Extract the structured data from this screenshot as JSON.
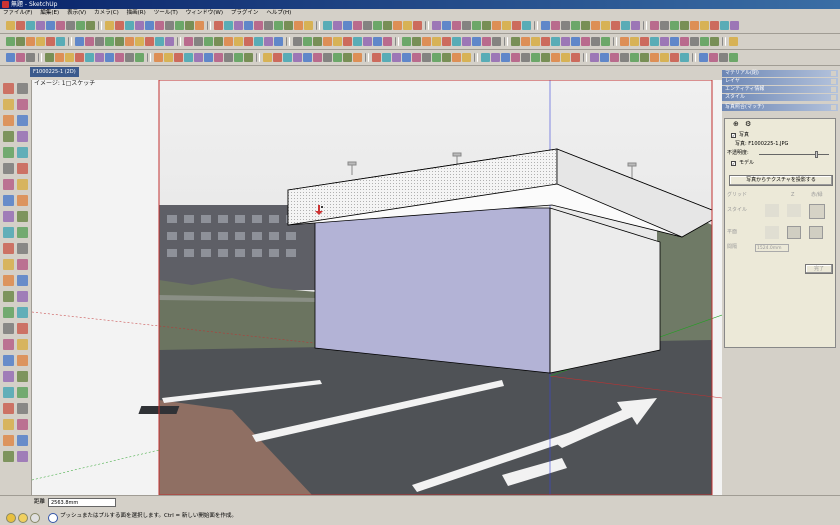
{
  "window": {
    "title": "無題 - SketchUp"
  },
  "menu": {
    "items": [
      "ファイル(F)",
      "編集(E)",
      "表示(V)",
      "カメラ(C)",
      "描画(R)",
      "ツール(T)",
      "ウィンドウ(W)",
      "プラグイン",
      "ヘルプ(H)"
    ]
  },
  "scene_tab": {
    "label": "F1000225-1 (2D)"
  },
  "viewport": {
    "scene_label": "イメージ: 1□スケッチ"
  },
  "right_panel": {
    "tray_headers": [
      "マテリアル(閉)",
      "レイヤ",
      "エンティティ情報",
      "スタイル",
      "写真照合(マッチ)"
    ],
    "photo_checkbox_label": "写真",
    "photo_file": "写真: F1000225-1.JPG",
    "opacity_label": "不透明度:",
    "model_checkbox_label": "モデル",
    "project_button": "写真からテクスチャを投影する",
    "grid_label": "グリッド",
    "style_label": "スタイル",
    "plane_label": "平面",
    "spacing_label": "間隔",
    "spacing_value": "1524.0mm",
    "radio_a": "Z",
    "radio_b": "赤/緑",
    "done_button": "完了"
  },
  "status": {
    "measure_label": "距離",
    "measure_value": "2563.8mm",
    "hint": "プッシュまたはプルする面を選択します。Ctrl = 新しい開始面を作成。"
  },
  "colors": {
    "accent_blue": "#3b5a8c",
    "face_front": "#b3b3d6",
    "face_side": "#ececec",
    "title_bar": "#0a246a"
  }
}
